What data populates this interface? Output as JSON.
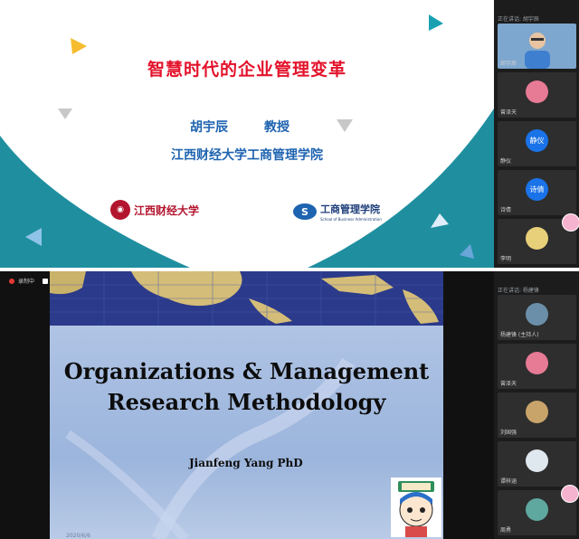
{
  "top": {
    "slide": {
      "title": "智慧时代的企业管理变革",
      "speaker": "胡宇辰",
      "role": "教授",
      "school": "江西财经大学工商管理学院",
      "logo_left": "江西财经大学",
      "logo_right_cn": "工商管理学院",
      "logo_right_en": "School of Business Administration",
      "colors": {
        "title": "#e3122b",
        "text": "#1e63b0",
        "wave": "#1f8fa0"
      }
    },
    "gallery": {
      "header": "正在讲话: 胡宇辰",
      "tiles": [
        {
          "name": "胡宇辰",
          "type": "video"
        },
        {
          "name": "曾泽天",
          "type": "avatar",
          "color": "#e77a95"
        },
        {
          "name": "静仪",
          "initials": "静仪",
          "type": "text"
        },
        {
          "name": "诗倩",
          "initials": "诗倩",
          "type": "text"
        },
        {
          "name": "李明",
          "type": "avatar",
          "color": "#e8d07a"
        }
      ]
    }
  },
  "bottom": {
    "record_label": "录制中",
    "slide": {
      "title_line1": "Organizations & Management",
      "title_line2": "Research Methodology",
      "author": "Jianfeng Yang  PhD",
      "date": "2020/6/6"
    },
    "gallery": {
      "header": "正在讲话: 杨建锋",
      "tiles": [
        {
          "name": "杨建锋 (主持人)",
          "type": "avatar",
          "color": "#6b8fa8"
        },
        {
          "name": "曾泽天",
          "type": "avatar",
          "color": "#e77a95"
        },
        {
          "name": "刘国强",
          "type": "avatar",
          "color": "#c9a46a"
        },
        {
          "name": "谭梓涵",
          "type": "avatar",
          "color": "#dfe7ef"
        },
        {
          "name": "周勇",
          "type": "avatar",
          "color": "#5fa8a0"
        }
      ]
    }
  }
}
